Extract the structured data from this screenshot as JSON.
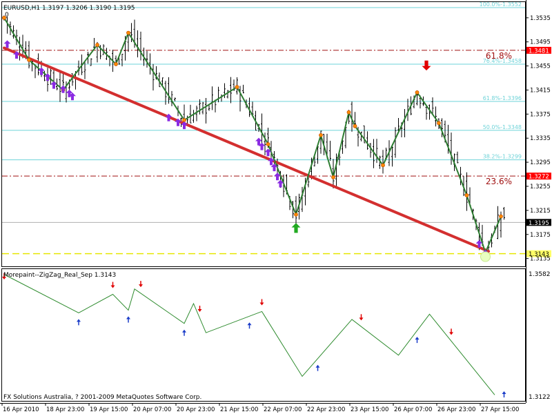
{
  "header": {
    "symbol_info": "EURUSD,H1  1.3197 1.3206 1.3190 1.3195",
    "zero_label": "0"
  },
  "indicator": {
    "title": "Morepaint--ZigZag_Real_Sep 1.3143",
    "copyright": "FX Solutions Australia, ? 2001-2009 MetaQuotes Software Corp.",
    "scale_top": "1.3582",
    "scale_bottom": "1.3122"
  },
  "colors": {
    "background": "#ffffff",
    "candle": "#000000",
    "zigzag": "#2e7d32",
    "trendline": "#d32f2f",
    "fibo": "#6ed3d8",
    "level_dashed": "#a01010",
    "yellow_line": "#e6e600",
    "arrow_up": "#8a2be2",
    "arrow_down": "#d00000",
    "ind_line": "#2e8b2e",
    "ind_up": "#1a3cc8",
    "ind_down": "#e00000",
    "price_label_bg": "#ff0000",
    "current_label_bg": "#000000"
  },
  "chart_data": {
    "type": "line",
    "symbol": "EURUSD",
    "timeframe": "H1",
    "ylim": [
      1.3122,
      1.356
    ],
    "price_ticks": [
      "1.3535",
      "1.3495",
      "1.3455",
      "1.3415",
      "1.3375",
      "1.3335",
      "1.3295",
      "1.3255",
      "1.3215",
      "1.3175",
      "1.3135"
    ],
    "time_ticks": [
      "16 Apr 2010",
      "18 Apr 23:00",
      "19 Apr 15:00",
      "20 Apr 07:00",
      "20 Apr 23:00",
      "21 Apr 15:00",
      "22 Apr 07:00",
      "22 Apr 23:00",
      "23 Apr 15:00",
      "26 Apr 07:00",
      "26 Apr 23:00",
      "27 Apr 15:00"
    ],
    "fibo_levels": [
      {
        "label": "100.0%-1.3552",
        "price": 1.3552
      },
      {
        "label": "76.4%-1.3458",
        "price": 1.3458
      },
      {
        "label": "61.8%-1.3396",
        "price": 1.3396
      },
      {
        "label": "50.0%-1.3348",
        "price": 1.3348
      },
      {
        "label": "38.2%-1.3299",
        "price": 1.3299
      }
    ],
    "horizontal_levels": [
      {
        "price": 1.3481,
        "label": "1.3481",
        "annotation": "61.8%"
      },
      {
        "price": 1.3272,
        "label": "1.3272",
        "annotation": "23.6%"
      }
    ],
    "current_price": {
      "price": 1.3195,
      "label": "1.3195"
    },
    "yellow_level": {
      "price": 1.3143,
      "label": "1.3143"
    },
    "zigzag": [
      {
        "i": 0,
        "p": 1.3535
      },
      {
        "i": 8,
        "p": 1.3465
      },
      {
        "i": 19,
        "p": 1.3415
      },
      {
        "i": 30,
        "p": 1.349
      },
      {
        "i": 36,
        "p": 1.3458
      },
      {
        "i": 40,
        "p": 1.351
      },
      {
        "i": 58,
        "p": 1.3365
      },
      {
        "i": 75,
        "p": 1.342
      },
      {
        "i": 85,
        "p": 1.3325
      },
      {
        "i": 94,
        "p": 1.3208
      },
      {
        "i": 102,
        "p": 1.334
      },
      {
        "i": 106,
        "p": 1.327
      },
      {
        "i": 111,
        "p": 1.3378
      },
      {
        "i": 113,
        "p": 1.3355
      },
      {
        "i": 122,
        "p": 1.329
      },
      {
        "i": 133,
        "p": 1.3411
      },
      {
        "i": 140,
        "p": 1.336
      },
      {
        "i": 149,
        "p": 1.324
      },
      {
        "i": 155,
        "p": 1.3145
      },
      {
        "i": 160,
        "p": 1.3205
      }
    ],
    "trendline": [
      {
        "i": 0,
        "p": 1.3485
      },
      {
        "i": 156,
        "p": 1.3147
      }
    ],
    "indicator_zigzag": [
      {
        "i": 0,
        "v": 1.3585
      },
      {
        "i": 24,
        "v": 1.344
      },
      {
        "i": 35,
        "v": 1.351
      },
      {
        "i": 40,
        "v": 1.345
      },
      {
        "i": 42,
        "v": 1.353
      },
      {
        "i": 58,
        "v": 1.34
      },
      {
        "i": 61,
        "v": 1.3475
      },
      {
        "i": 65,
        "v": 1.3365
      },
      {
        "i": 83,
        "v": 1.3445
      },
      {
        "i": 96,
        "v": 1.32
      },
      {
        "i": 112,
        "v": 1.3415
      },
      {
        "i": 127,
        "v": 1.328
      },
      {
        "i": 137,
        "v": 1.3435
      },
      {
        "i": 158,
        "v": 1.313
      }
    ],
    "indicator_ylim": [
      1.311,
      1.36
    ],
    "indicator_up_arrows": [
      24,
      40,
      58,
      79,
      101,
      133,
      161
    ],
    "indicator_down_arrows": [
      0,
      35,
      44,
      63,
      83,
      115,
      144
    ],
    "up_arrows": [
      {
        "i": 1,
        "p": 1.35
      },
      {
        "i": 4,
        "p": 1.3482
      },
      {
        "i": 12,
        "p": 1.3455
      },
      {
        "i": 14,
        "p": 1.3445
      },
      {
        "i": 16,
        "p": 1.3432
      },
      {
        "i": 19,
        "p": 1.3425
      },
      {
        "i": 21,
        "p": 1.3418
      },
      {
        "i": 22,
        "p": 1.3413
      },
      {
        "i": 53,
        "p": 1.3378
      },
      {
        "i": 56,
        "p": 1.337
      },
      {
        "i": 58,
        "p": 1.3365
      },
      {
        "i": 82,
        "p": 1.3338
      },
      {
        "i": 83,
        "p": 1.333
      },
      {
        "i": 85,
        "p": 1.332
      },
      {
        "i": 86,
        "p": 1.3305
      },
      {
        "i": 87,
        "p": 1.3295
      },
      {
        "i": 88,
        "p": 1.328
      },
      {
        "i": 89,
        "p": 1.3268
      },
      {
        "i": 153,
        "p": 1.3168
      },
      {
        "i": 155,
        "p": 1.3152
      }
    ],
    "down_arrows": [
      {
        "i": 136,
        "p": 1.3445
      }
    ],
    "big_up_arrow": {
      "i": 94,
      "p": 1.3192
    }
  }
}
